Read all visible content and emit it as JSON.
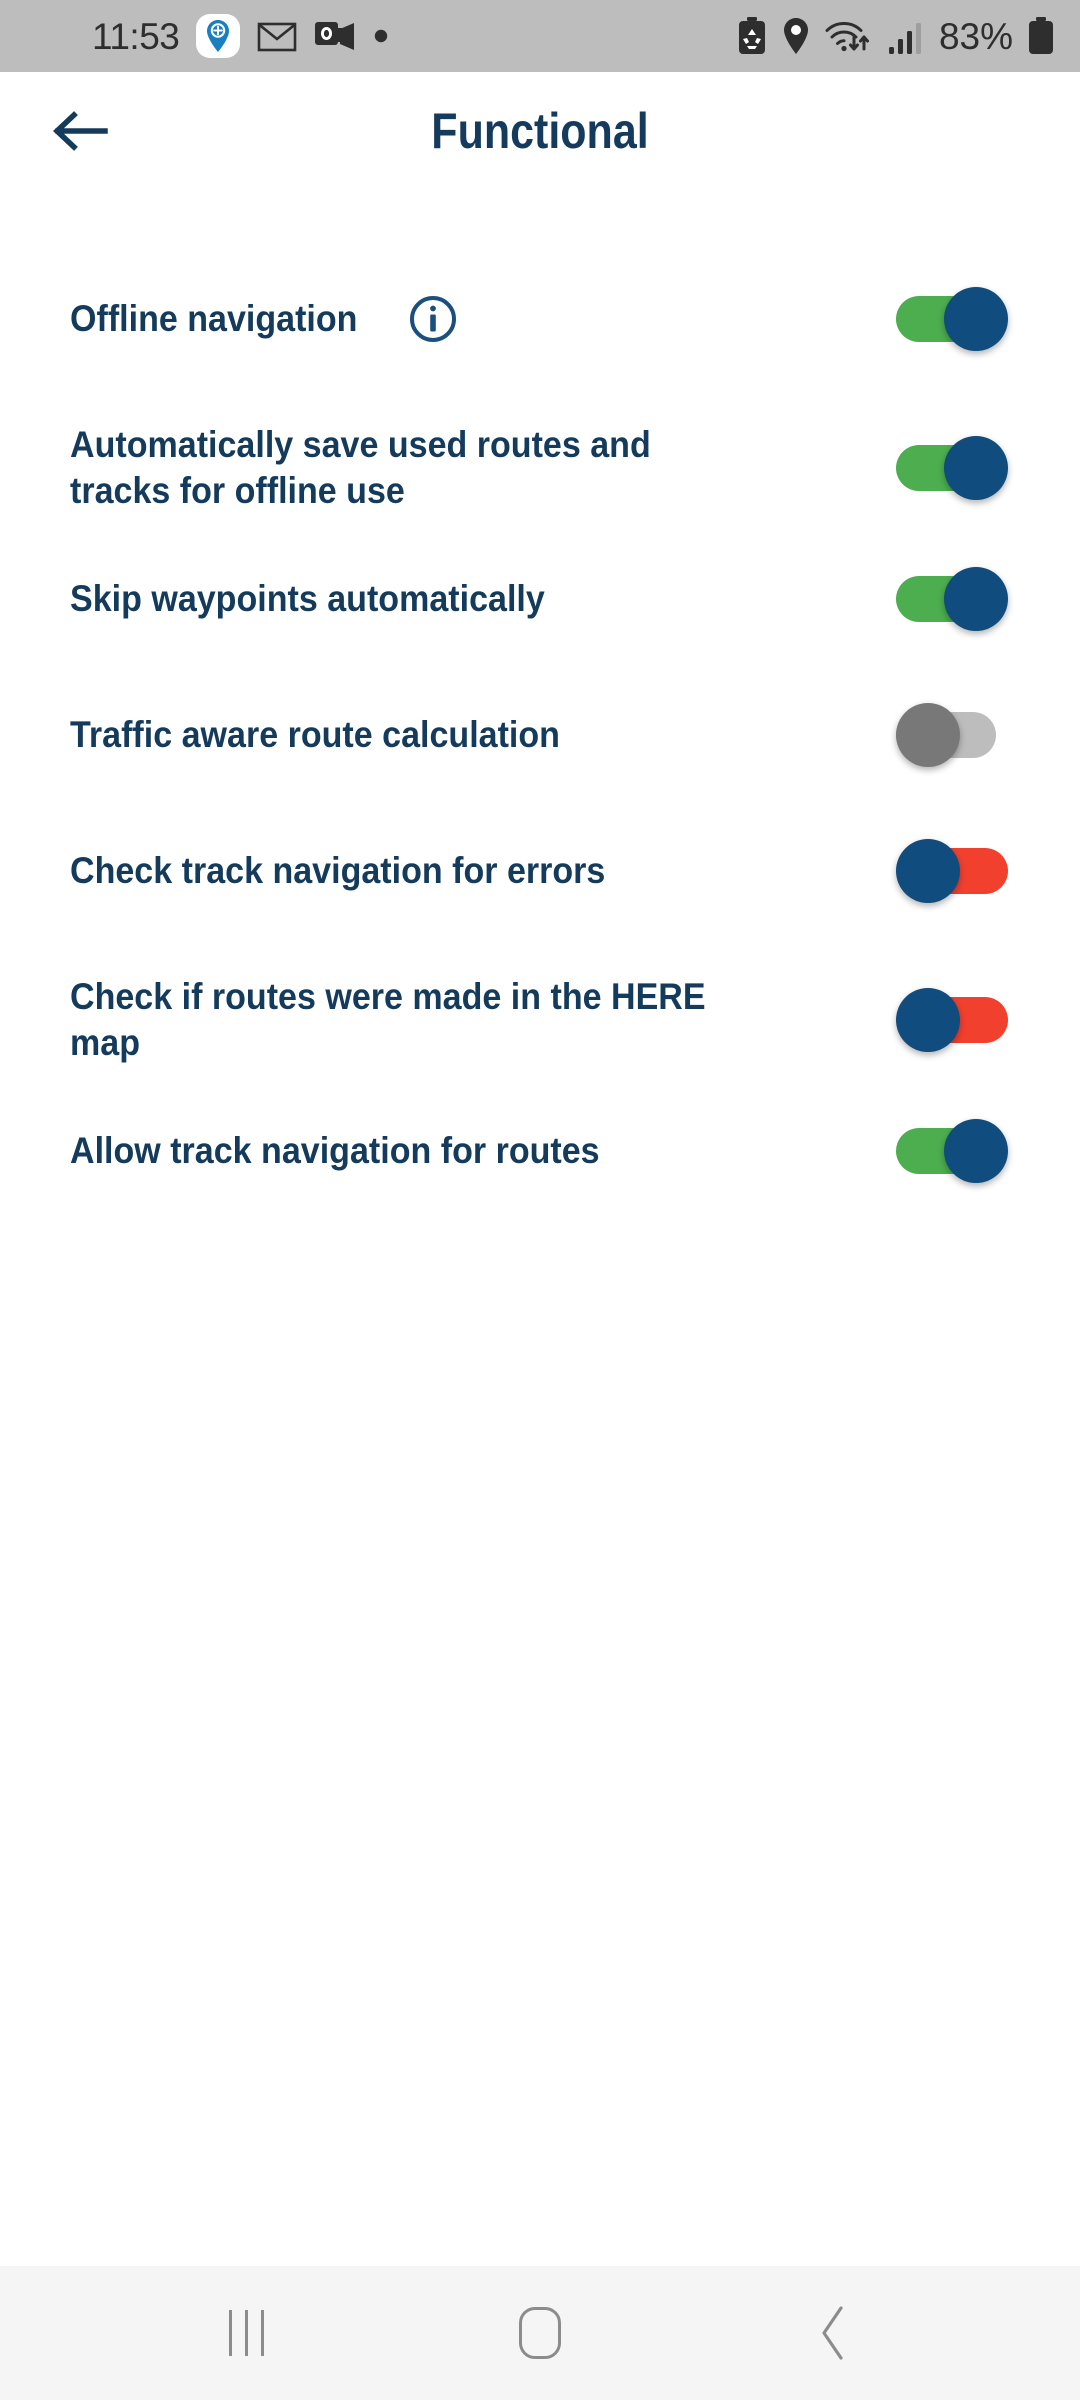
{
  "status_bar": {
    "time": "11:53",
    "battery_percent": "83%",
    "left_icons": [
      "location-pin-badge-icon",
      "envelope-icon",
      "outlook-icon",
      "dot-icon"
    ],
    "right_icons": [
      "battery-saver-icon",
      "location-icon",
      "wifi-transfer-icon",
      "signal-bars-icon",
      "battery-icon"
    ],
    "background_color": "#bdbdbd"
  },
  "header": {
    "title": "Functional",
    "back_icon": "arrow-left-icon",
    "title_color": "#143b5c"
  },
  "colors": {
    "accent_navy": "#104C7E",
    "text_navy": "#143b5c",
    "toggle_on_green": "#4CAE4F",
    "toggle_off_gray_track": "#bdbdbd",
    "toggle_off_gray_thumb": "#787878",
    "toggle_off_red": "#F2402F",
    "page_background": "#ffffff",
    "nav_bar_background": "#f5f5f5"
  },
  "settings": [
    {
      "label": "Offline navigation",
      "has_info_icon": true,
      "info_icon": "info-circle-icon",
      "toggle_state": "on",
      "toggle_style": "green-navy",
      "name": "offline-navigation"
    },
    {
      "label": "Automatically save used routes and tracks for offline use",
      "has_info_icon": false,
      "toggle_state": "on",
      "toggle_style": "green-navy",
      "name": "auto-save-routes-tracks"
    },
    {
      "label": "Skip waypoints automatically",
      "has_info_icon": false,
      "toggle_state": "on",
      "toggle_style": "green-navy",
      "name": "skip-waypoints-automatically"
    },
    {
      "label": "Traffic aware route calculation",
      "has_info_icon": false,
      "toggle_state": "off",
      "toggle_style": "gray-disabled",
      "name": "traffic-aware-route-calculation"
    },
    {
      "label": "Check track navigation for errors",
      "has_info_icon": false,
      "toggle_state": "off",
      "toggle_style": "red-navy",
      "name": "check-track-navigation-errors"
    },
    {
      "label": "Check if routes were made in the HERE map",
      "has_info_icon": false,
      "toggle_state": "off",
      "toggle_style": "red-navy",
      "name": "check-routes-here-map"
    },
    {
      "label": "Allow track navigation for routes",
      "has_info_icon": false,
      "toggle_state": "on",
      "toggle_style": "green-navy",
      "name": "allow-track-navigation-routes"
    }
  ],
  "nav_bar": {
    "buttons": [
      {
        "name": "recent-apps-button",
        "icon": "recent-apps-icon"
      },
      {
        "name": "home-button",
        "icon": "home-icon"
      },
      {
        "name": "back-button",
        "icon": "chevron-left-icon"
      }
    ]
  }
}
